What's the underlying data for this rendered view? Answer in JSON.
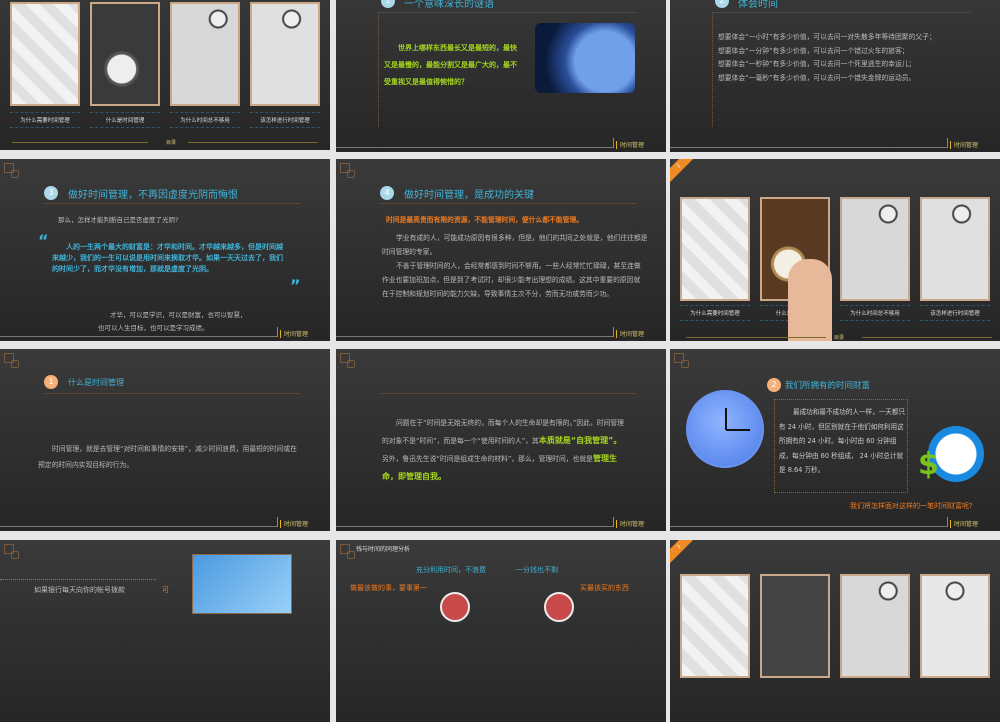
{
  "common": {
    "footer": "时间管理",
    "toc_label": "目录"
  },
  "toc_cards": [
    "为什么需要时间管理",
    "什么是时间管理",
    "为什么时间总不够用",
    "该怎样进行时间管理"
  ],
  "slide_riddle": {
    "badge": "1",
    "title": "一个意味深长的谜语",
    "text": "世界上哪样东西最长又是最短的，最快又是最慢的，最能分割又是最广大的，最不受重视又是最值得惋惜的？"
  },
  "slide_experience": {
    "badge": "2",
    "title": "体会时间",
    "lines": [
      "想要体会“一小时”有多少价值，可以去问一对失散多年等待团聚的父子；",
      "想要体会“一分钟”有多少价值，可以去问一个错过火车的旅客；",
      "想要体会“一秒钟”有多少价值，可以去问一个死里逃生的幸运儿；",
      "想要体会“一毫秒”有多少价值，可以去问一个错失金牌的运动员。"
    ]
  },
  "slide_regret": {
    "badge": "3",
    "title": "做好时间管理，不再因虚度光阴而悔恨",
    "question": "那么，怎样才能判断自己是否虚度了光阴?",
    "quote": "人的一生两个最大的财富是：才华和时间。才华越来越多，但是时间越来越少，我们的一生可以说是用时间来换取才华。如果一天天过去了，我们的时间少了，而才华没有增加，那就是虚度了光阴。",
    "note1": "才华，可以是学识，可以是财富，也可以智慧，",
    "note2": "也可以人生目标，也可以是学习成绩。"
  },
  "slide_key": {
    "badge": "4",
    "title": "做好时间管理，是成功的关键",
    "highlight": "时间是最高贵而有限的资源，不能管理时间，便什么都不能管理。",
    "p1": "学业有成的人，可能成功原因有很多种，但是，他们的共同之处就是，他们往往都是时间管理的专家。",
    "p2": "不善于管理时间的人，会经常都感到时间不够用。一些人经常忙忙碌碌，甚至连做作业也要加班加点，但是到了考试时，却很少能考出理想的成绩。这其中重要的原因就在于控制和规划时间的能力欠缺，导致事情主次不分，劳而无功或劳而少功。"
  },
  "section2_ribbon": "2",
  "section3_ribbon": "3",
  "slide_what": {
    "badge": "1",
    "title": "什么是时间管理",
    "text": "时间管理，就是去管理“对时间和事情的安排”，减少时间浪费，用最短的时间或在预定的时间内实现目标的行为。"
  },
  "slide_essence": {
    "t1": "问题在于“时间是无始无终的，而每个人的生命却是有限的。”因此，时间管理的对象不是“时间”，而是每一个“使用时间的人”，其",
    "b1": "本质就是“自我管理”。",
    "t2": "另外，鲁迅先生说“时间是组成生命的材料”，那么，管理时间，也就是",
    "b2": "管理生命，即管理自我。"
  },
  "slide_wealth": {
    "badge": "2",
    "title": "我们所拥有的时间财富",
    "text": "最成功和最不成功的人一样，一天都只有 24 小时，但区别就在于他们如何利用这所拥有的 24 小时。每小时由 60 分钟组成，每分钟由 60 秒组成， 24 小时总计就是 8.64 万秒。",
    "question": "我们将怎样面对这样的一笔时间财富呢?"
  },
  "slide_bank": {
    "text": "如果银行每天向你的帐号拨款",
    "side": "可"
  },
  "slide_analysis": {
    "title": "钱与时间的同理分析",
    "l1": "充分利用时间，不浪费",
    "l2": "做最该做的事，要事第一",
    "r1": "一分钱也不剩",
    "r2": "买最该买的东西"
  },
  "colors": {
    "accent_blue": "#3fb3d8",
    "accent_green": "#a6d61e",
    "accent_orange": "#f07a1e",
    "footer_gold": "#d6c46a"
  }
}
